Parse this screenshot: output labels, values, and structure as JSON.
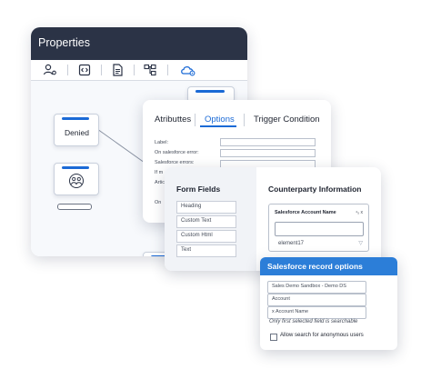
{
  "properties": {
    "title": "Properties",
    "toolbar": [
      "users-gear-icon",
      "code-icon",
      "document-icon",
      "hierarchy-icon",
      "cloud-settings-icon"
    ],
    "active_tool_color": "#1b6ad6",
    "nodes": {
      "denied_label": "Denied"
    }
  },
  "attributes": {
    "tabs": [
      "Atributtes",
      "Options",
      "Trigger Condition"
    ],
    "active_tab": "Options",
    "fields": [
      "Label:",
      "On salesforce error:",
      "Salesforce errors:",
      "If m",
      "Artic",
      "On"
    ]
  },
  "form_fields": {
    "title": "Form Fields",
    "items": [
      "Heading",
      "Custom Text",
      "Custom Html",
      "Text"
    ]
  },
  "counterparty": {
    "title": "Counterparty Information",
    "account_label": "Salesforce Account Name",
    "account_tag": "⁴₅ x",
    "value": "element17"
  },
  "salesforce_options": {
    "title": "Salesforce record options",
    "org": "Sales Demo Sandbox - Demo DS",
    "object": "Account",
    "selected_field": "x  Account Name",
    "note": "Only first selected field is searchable",
    "checkbox_label": "Allow search for anonymous users",
    "accent": "#2c7ed8"
  }
}
